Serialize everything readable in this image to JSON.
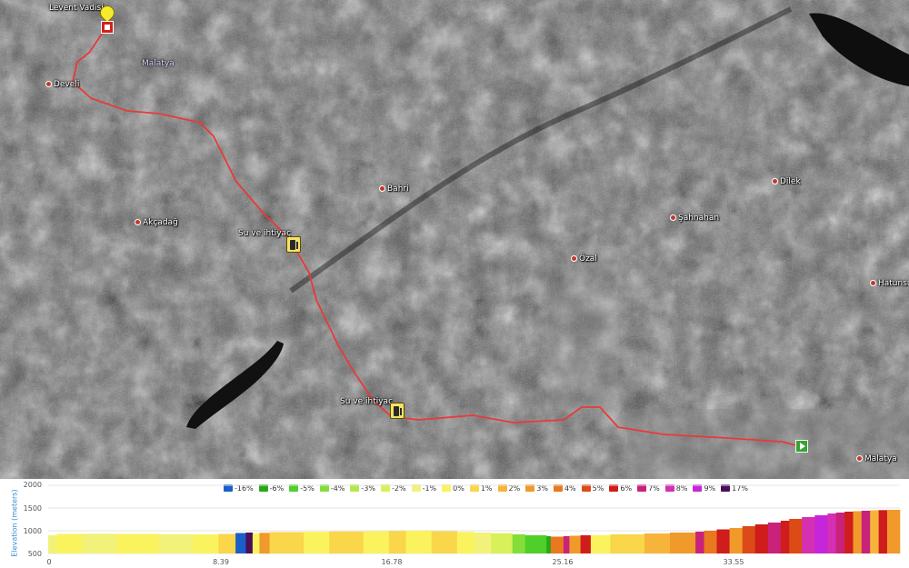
{
  "map": {
    "places": [
      {
        "id": "levent-vadisi",
        "label": "Levent Vadisi"
      },
      {
        "id": "develi",
        "label": "Develi"
      },
      {
        "id": "akcadag",
        "label": "Akçadağ"
      },
      {
        "id": "bahri",
        "label": "Bahri"
      },
      {
        "id": "ozal",
        "label": "Özal"
      },
      {
        "id": "sahnahan",
        "label": "Şahnahan"
      },
      {
        "id": "dilek",
        "label": "Dilek"
      },
      {
        "id": "hatunsuyu",
        "label": "Hatunsuyu"
      },
      {
        "id": "malatya-city",
        "label": "Malatya"
      }
    ],
    "region_label": "Malatya",
    "poi_1": "Su ve ihtiyaç",
    "poi_2": "Su ve ihtiyaç",
    "route_color": "#e83a3a"
  },
  "profile": {
    "ylabel": "Elevation (meters)",
    "yticks": [
      "2000",
      "1500",
      "1000",
      "500"
    ],
    "xticks": [
      "0",
      "8.39",
      "16.78",
      "25.16",
      "33.55"
    ],
    "legend": [
      {
        "label": "-16%",
        "color": "#1a5fc8"
      },
      {
        "label": "-6%",
        "color": "#27a81b"
      },
      {
        "label": "-5%",
        "color": "#4fcf29"
      },
      {
        "label": "-4%",
        "color": "#86dd3a"
      },
      {
        "label": "-3%",
        "color": "#b4e84a"
      },
      {
        "label": "-2%",
        "color": "#d8f05a"
      },
      {
        "label": "-1%",
        "color": "#f2f27a"
      },
      {
        "label": "0%",
        "color": "#fbf35e"
      },
      {
        "label": "1%",
        "color": "#f9d64a"
      },
      {
        "label": "2%",
        "color": "#f6b53a"
      },
      {
        "label": "3%",
        "color": "#f09a2b"
      },
      {
        "label": "4%",
        "color": "#e9781f"
      },
      {
        "label": "5%",
        "color": "#db4a17"
      },
      {
        "label": "6%",
        "color": "#cf1c1c"
      },
      {
        "label": "7%",
        "color": "#c8227a"
      },
      {
        "label": "8%",
        "color": "#d52fb3"
      },
      {
        "label": "9%",
        "color": "#c526d9"
      },
      {
        "label": "17%",
        "color": "#4a0f5a"
      }
    ]
  }
}
